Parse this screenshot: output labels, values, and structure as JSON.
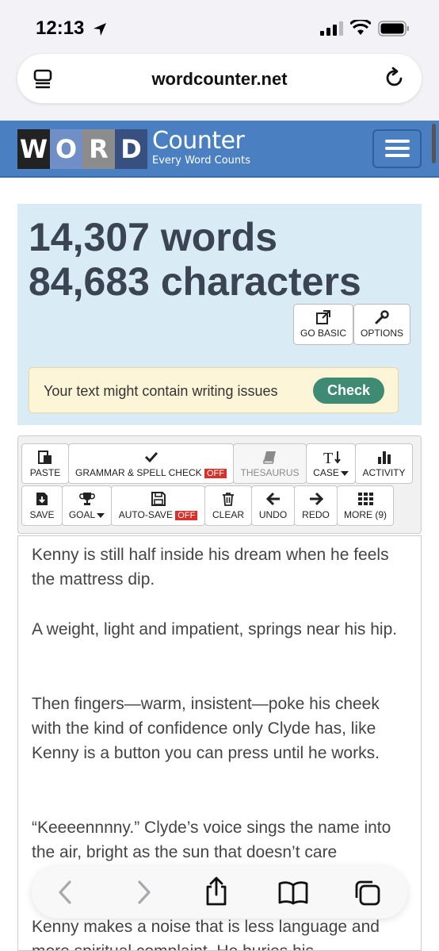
{
  "status_bar": {
    "time": "12:13"
  },
  "address_bar": {
    "url": "wordcounter.net"
  },
  "site_header": {
    "logo_letters": [
      "W",
      "O",
      "R",
      "D"
    ],
    "logo_word": "Counter",
    "tagline": "Every Word Counts"
  },
  "stats": {
    "words": "14,307 words",
    "characters": "84,683 characters",
    "go_basic_label": "GO BASIC",
    "options_label": "OPTIONS",
    "issues_text": "Your text might contain writing issues",
    "check_label": "Check"
  },
  "toolbar": {
    "paste": "PASTE",
    "grammar": "GRAMMAR & SPELL CHECK",
    "grammar_state": "OFF",
    "thesaurus": "THESAURUS",
    "case": "CASE",
    "activity": "ACTIVITY",
    "save": "SAVE",
    "goal": "GOAL",
    "autosave": "AUTO-SAVE",
    "autosave_state": "OFF",
    "clear": "CLEAR",
    "undo": "UNDO",
    "redo": "REDO",
    "more": "MORE (9)"
  },
  "editor": {
    "paragraphs": [
      "Kenny is still half inside his dream when he feels the mattress dip.",
      "A weight, light and impatient, springs near his hip.",
      "Then fingers—warm, insistent—poke his cheek with the kind of confidence only Clyde has, like Kenny is a button you can press until he works.",
      "“Keeeennnny.” Clyde’s voice sings the name into the air, bright as the sun that doesn’t care",
      "Kenny makes a noise that is less language and more spiritual complaint. He buries his"
    ]
  },
  "colors": {
    "header_blue": "#4a7fc1",
    "stats_bg": "#d9ebf5",
    "check_green": "#3e8a72",
    "off_red": "#d8302b"
  }
}
